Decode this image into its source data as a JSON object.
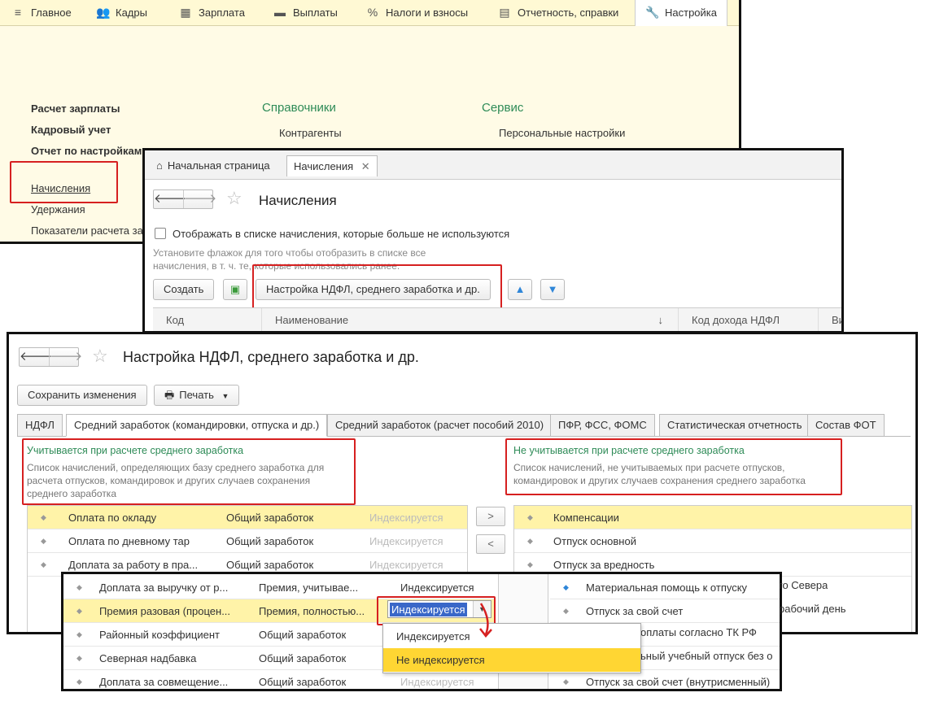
{
  "main_menu": {
    "items": [
      {
        "label": "Главное",
        "icon": "menu-icon"
      },
      {
        "label": "Кадры",
        "icon": "people-icon"
      },
      {
        "label": "Зарплата",
        "icon": "calculator-icon"
      },
      {
        "label": "Выплаты",
        "icon": "wallet-icon"
      },
      {
        "label": "Налоги и взносы",
        "icon": "percent-icon"
      },
      {
        "label": "Отчетность, справки",
        "icon": "report-icon"
      },
      {
        "label": "Настройка",
        "icon": "wrench-icon"
      }
    ],
    "sections": {
      "salary_calc": "Расчет зарплаты",
      "hr_accounting": "Кадровый учет",
      "settings_report": "Отчет по настройкам",
      "references_head": "Справочники",
      "service_head": "Сервис",
      "contractors": "Контрагенты",
      "personal_settings": "Персональные настройки",
      "accruals": "Начисления",
      "deductions": "Удержания",
      "indicators": "Показатели расчета за"
    }
  },
  "accruals_window": {
    "home_tab": "Начальная страница",
    "active_tab": "Начисления",
    "title": "Начисления",
    "checkbox_label": "Отображать в списке начисления, которые больше не используются",
    "hint": "Установите флажок для того чтобы отобразить в списке все начисления, в т. ч. те, которые использовались ранее.",
    "create_button": "Создать",
    "ndfl_button": "Настройка НДФЛ, среднего заработка и др.",
    "columns": [
      "Код",
      "Наименование",
      "Код дохода НДФЛ",
      "Ви"
    ]
  },
  "ndfl_window": {
    "title": "Настройка НДФЛ, среднего заработка и др.",
    "save_button": "Сохранить изменения",
    "print_button": "Печать",
    "tabs": [
      "НДФЛ",
      "Средний заработок (командировки, отпуска и др.)",
      "Средний заработок (расчет пособий 2010)",
      "ПФР, ФСС, ФОМС",
      "Статистическая отчетность",
      "Состав ФОТ"
    ],
    "left_group": {
      "heading": "Учитывается при расчете среднего заработка",
      "description": "Список начислений, определяющих базу среднего заработка для расчета отпусков, командировок и других случаев сохранения среднего заработка",
      "rows": [
        {
          "name": "Оплата по окладу",
          "kind": "Общий заработок",
          "index": "Индексируется"
        },
        {
          "name": "Оплата по дневному тар",
          "kind": "Общий заработок",
          "index": "Индексируется"
        },
        {
          "name": "Доплата за работу в пра...",
          "kind": "Общий заработок",
          "index": "Индексируется"
        }
      ]
    },
    "right_group": {
      "heading": "Не учитывается при расчете среднего заработка",
      "description": "Список начислений, не учитываемых при расчете отпусков, командировок и других случаев сохранения среднего заработка",
      "rows": [
        "Компенсации",
        "Отпуск основной",
        "Отпуск за вредность"
      ]
    },
    "move_right": ">",
    "move_left": "<"
  },
  "zoom_window": {
    "left_rows": [
      {
        "name": "Доплата за выручку от р...",
        "kind": "Премия, учитывае...",
        "index": "Индексируется"
      },
      {
        "name": "Премия разовая (процен...",
        "kind": "Премия, полностью...",
        "index": "Индексируется"
      },
      {
        "name": "Районный коэффициент",
        "kind": "Общий заработок",
        "index": ""
      },
      {
        "name": "Северная надбавка",
        "kind": "Общий заработок",
        "index": ""
      },
      {
        "name": "Доплата за совмещение...",
        "kind": "Общий заработок",
        "index": "Индексируется"
      }
    ],
    "right_rows": [
      {
        "name": "Материальная помощь к отпуску",
        "tail": "го Севера"
      },
      {
        "name": "Отпуск за свой счет",
        "tail": "рабочий день"
      },
      {
        "name": "",
        "tail": "оплаты согласно ТК РФ"
      },
      {
        "name": "",
        "tail": "ьный учебный отпуск без о"
      },
      {
        "name": "Отпуск за свой счет (внутрисменный)",
        "tail": ""
      }
    ],
    "dropdown_value": "Индексируется",
    "dropdown_options": [
      "Индексируется",
      "Не индексируется"
    ]
  },
  "colors": {
    "accent_green": "#2e8b57",
    "highlight_red": "#d62020",
    "selected_row": "#fff3a8",
    "menu_bg": "#fff9d4",
    "dropdown_highlight": "#ffd633"
  }
}
